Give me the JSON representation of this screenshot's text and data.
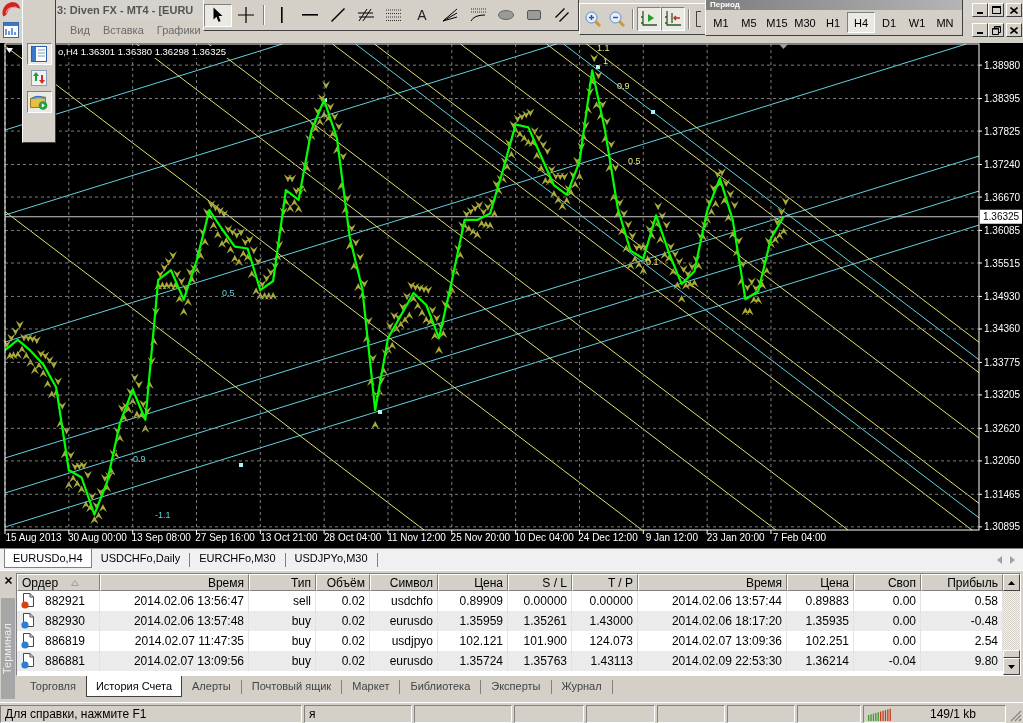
{
  "title_bar": {
    "title": "3: Diven FX - MT4 - [EURU"
  },
  "menu": [
    "Вид",
    "Вставка",
    "Графики"
  ],
  "side_toolbar": [
    {
      "kind": "window-list",
      "selected": true
    },
    {
      "kind": "transfer",
      "selected": false
    },
    {
      "kind": "folder-run",
      "selected": true
    }
  ],
  "drawing_toolbar": {
    "groups": [
      [
        {
          "kind": "cursor",
          "selected": true
        },
        {
          "kind": "crosshair",
          "selected": false
        }
      ],
      [
        {
          "kind": "vertical-line",
          "selected": false
        },
        {
          "kind": "horizontal-line",
          "selected": false
        },
        {
          "kind": "trend-line",
          "selected": false
        },
        {
          "kind": "channel",
          "selected": false
        },
        {
          "kind": "fibo-levels",
          "selected": false
        },
        {
          "kind": "text",
          "label": "A",
          "selected": false
        },
        {
          "kind": "fan",
          "selected": false
        },
        {
          "kind": "arcs",
          "selected": false
        },
        {
          "kind": "ellipse",
          "selected": false
        },
        {
          "kind": "rectangle",
          "selected": false
        },
        {
          "kind": "parallel",
          "selected": false
        }
      ]
    ]
  },
  "chart_toolbar": {
    "groups": [
      [
        {
          "kind": "zoom-in",
          "selected": false
        },
        {
          "kind": "zoom-out",
          "selected": false
        }
      ],
      [
        {
          "kind": "autoscroll",
          "selected": true
        },
        {
          "kind": "chart-shift",
          "selected": true
        }
      ],
      [
        {
          "kind": "panel",
          "selected": false
        }
      ]
    ]
  },
  "period_toolbar": {
    "title": "Период",
    "periods": [
      {
        "label": "M1",
        "selected": false
      },
      {
        "label": "M5",
        "selected": false
      },
      {
        "label": "M15",
        "selected": false
      },
      {
        "label": "M30",
        "selected": false
      },
      {
        "label": "H1",
        "selected": false
      },
      {
        "label": "H4",
        "selected": true
      },
      {
        "label": "D1",
        "selected": false
      },
      {
        "label": "W1",
        "selected": false
      },
      {
        "label": "MN",
        "selected": false
      }
    ]
  },
  "chart": {
    "header": "o,H4 1.36301 1.36380 1.36298 1.36325",
    "chart_data": {
      "type": "line",
      "grid": true,
      "categories": [
        null,
        null,
        "15 Aug 2013",
        null,
        null,
        null,
        null,
        "30 Aug 00:00",
        null,
        null,
        null,
        null,
        "13 Sep 08:00",
        null,
        null,
        null,
        null,
        "27 Sep 16:00",
        null,
        null,
        null,
        null,
        "13 Oct 21:00",
        null,
        null,
        null,
        null,
        "28 Oct 04:00",
        null,
        null,
        null,
        null,
        "11 Nov 12:00",
        null,
        null,
        null,
        null,
        "25 Nov 20:00",
        null,
        null,
        null,
        null,
        "10 Dec 04:00",
        null,
        null,
        null,
        null,
        "24 Dec 12:00",
        null,
        null,
        null,
        null,
        "9 Jan 12:00",
        null,
        null,
        null,
        null,
        "23 Jan 20:00",
        null,
        null,
        null,
        null,
        "7 Feb 04:00"
      ],
      "series": [
        {
          "color": "#00ff00",
          "values": [
            1.3399,
            1.3417,
            1.3398,
            1.3374,
            1.3334,
            1.3189,
            1.3176,
            1.3111,
            1.3168,
            1.3271,
            1.333,
            1.3277,
            1.3522,
            1.3539,
            1.3487,
            1.3555,
            1.3644,
            1.3611,
            1.358,
            1.3577,
            1.3504,
            1.352,
            1.3679,
            1.3662,
            1.3784,
            1.3837,
            1.377,
            1.3597,
            1.3505,
            1.3294,
            1.342,
            1.3459,
            1.3499,
            1.3478,
            1.342,
            1.352,
            1.3627,
            1.3627,
            1.3638,
            1.3714,
            1.3794,
            1.3789,
            1.3738,
            1.3688,
            1.3671,
            1.3729,
            1.3889,
            1.3784,
            1.3647,
            1.3573,
            1.3559,
            1.3635,
            1.357,
            1.3515,
            1.3537,
            1.3643,
            1.37,
            1.3627,
            1.3488,
            1.3502,
            1.3595,
            1.3633,
            null
          ]
        }
      ],
      "ylim": [
        1.3084,
        1.3935
      ],
      "yticks": [
        {
          "value": 1.3898,
          "label": "1.38980"
        },
        {
          "value": 1.38395,
          "label": "1.38395"
        },
        {
          "value": 1.37825,
          "label": "1.37825"
        },
        {
          "value": 1.3724,
          "label": "1.37240"
        },
        {
          "value": 1.3667,
          "label": "1.36670"
        },
        {
          "value": 1.36085,
          "label": "1.36085"
        },
        {
          "value": 1.35515,
          "label": "1.35515"
        },
        {
          "value": 1.3493,
          "label": "1.34930"
        },
        {
          "value": 1.3436,
          "label": "1.34360"
        },
        {
          "value": 1.33775,
          "label": "1.33775"
        },
        {
          "value": 1.33205,
          "label": "1.33205"
        },
        {
          "value": 1.3262,
          "label": "1.32620"
        },
        {
          "value": 1.3205,
          "label": "1.32050"
        },
        {
          "value": 1.31465,
          "label": "1.31465"
        },
        {
          "value": 1.30895,
          "label": "1.30895"
        }
      ],
      "ref_lines": [
        {
          "axis": "y",
          "value": 1.36325,
          "label": "1.36325"
        }
      ],
      "annotations": [
        "1.1",
        "1",
        "0.9",
        "0.5",
        "0.1",
        "0.5",
        "-0.9",
        "-1.1"
      ]
    }
  },
  "chart_tabs": [
    {
      "label": "EURUSDo,H4",
      "selected": true
    },
    {
      "label": "USDCHFo,Daily",
      "selected": false
    },
    {
      "label": "EURCHFo,M30",
      "selected": false
    },
    {
      "label": "USDJPYo,M30",
      "selected": false
    }
  ],
  "terminal": {
    "title": "Терминал",
    "columns": [
      {
        "label": "Ордер",
        "sorted": true
      },
      {
        "label": "Время",
        "sorted": false
      },
      {
        "label": "Тип",
        "sorted": false
      },
      {
        "label": "Объём",
        "sorted": false
      },
      {
        "label": "Символ",
        "sorted": false
      },
      {
        "label": "Цена",
        "sorted": false
      },
      {
        "label": "S / L",
        "sorted": false
      },
      {
        "label": "T / P",
        "sorted": false
      },
      {
        "label": "Время",
        "sorted": false
      },
      {
        "label": "Цена",
        "sorted": false
      },
      {
        "label": "Своп",
        "sorted": false
      },
      {
        "label": "Прибыль",
        "sorted": false
      }
    ],
    "rows": [
      {
        "kind": "sell",
        "cells": [
          "882921",
          "2014.02.06 13:56:47",
          "sell",
          "0.02",
          "usdchfo",
          "0.89909",
          "0.00000",
          "0.00000",
          "2014.02.06 13:57:44",
          "0.89883",
          "0.00",
          "0.58"
        ]
      },
      {
        "kind": "buy",
        "cells": [
          "882930",
          "2014.02.06 13:57:48",
          "buy",
          "0.02",
          "eurusdo",
          "1.35959",
          "1.35261",
          "1.43000",
          "2014.02.06 18:17:20",
          "1.35935",
          "0.00",
          "-0.48"
        ]
      },
      {
        "kind": "buy",
        "cells": [
          "886819",
          "2014.02.07 11:47:35",
          "buy",
          "0.02",
          "usdjpyo",
          "102.121",
          "101.900",
          "124.073",
          "2014.02.07 13:09:36",
          "102.251",
          "0.00",
          "2.54"
        ]
      },
      {
        "kind": "buy",
        "cells": [
          "886881",
          "2014.02.07 13:09:56",
          "buy",
          "0.02",
          "eurusdo",
          "1.35724",
          "1.35763",
          "1.43113",
          "2014.02.09 22:53:30",
          "1.36214",
          "-0.04",
          "9.80"
        ]
      }
    ],
    "tabs": [
      {
        "label": "Торговля",
        "selected": false
      },
      {
        "label": "История Счета",
        "selected": true
      },
      {
        "label": "Алерты",
        "selected": false
      },
      {
        "label": "Почтовый ящик",
        "selected": false
      },
      {
        "label": "Маркет",
        "selected": false
      },
      {
        "label": "Библиотека",
        "selected": false
      },
      {
        "label": "Эксперты",
        "selected": false
      },
      {
        "label": "Журнал",
        "selected": false
      }
    ]
  },
  "status_bar": {
    "help": "Для справки, нажмите F1",
    "profile": "я",
    "traffic": "149/1 kb"
  }
}
